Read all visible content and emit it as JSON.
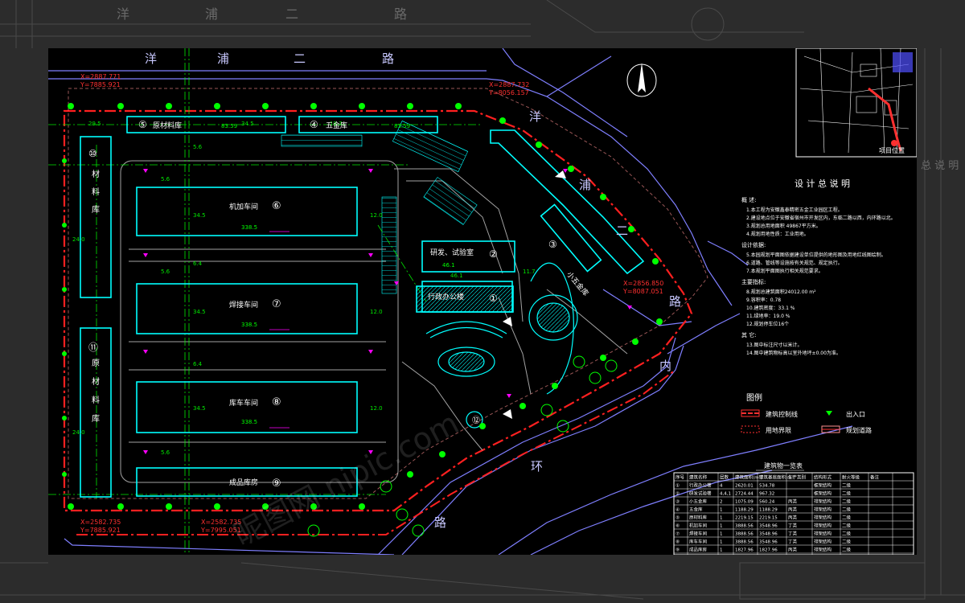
{
  "roads": {
    "road_top": "洋 浦 二 路",
    "road_right_1": "洋",
    "road_right_2": "浦",
    "road_right_3": "二",
    "road_right_4": "路",
    "road_bottom_1": "内",
    "road_bottom_2": "环",
    "road_bottom_3": "路"
  },
  "coords": {
    "tl_x": "X=2887.771",
    "tl_y": "Y=7885.921",
    "tr_x": "X=2887.732",
    "tr_y": "Y=8056.157",
    "right_x": "X=2856.850",
    "right_y": "Y=8087.051",
    "bl_x": "X=2582.735",
    "bl_y": "Y=7885.921",
    "bm_x": "X=2582.735",
    "bm_y": "Y=7995.051"
  },
  "buildings": [
    {
      "num": "⑤",
      "name": "原材料库",
      "area": "83.59"
    },
    {
      "num": "④",
      "name": "五金库",
      "area": "83.59"
    },
    {
      "num": "⑩",
      "name": "材料库",
      "area": "34.0"
    },
    {
      "num": "⑥",
      "name": "机加车间",
      "area": "338.5"
    },
    {
      "num": "⑦",
      "name": "焊接车间",
      "area": "338.5"
    },
    {
      "num": "⑧",
      "name": "库车车间",
      "area": "338.5"
    },
    {
      "num": "⑨",
      "name": "成品库房",
      "area": "338.5"
    },
    {
      "num": "⑪",
      "name": "原材料库",
      "area": "34.0"
    },
    {
      "num": "②",
      "name": "研发、试验室",
      "area": "46.1"
    },
    {
      "num": "①",
      "name": "行政办公楼",
      "area": ""
    },
    {
      "num": "③",
      "name": "小五金库",
      "area": ""
    },
    {
      "num": "⑫",
      "name": "",
      "area": ""
    }
  ],
  "notes": {
    "title": "设 计 总 说 明",
    "section1": "概 述:",
    "lines1": [
      "1.本工程为安徽鑫泰精密五金工业园区工程。",
      "2.建设地点位于安徽省宿州市开发区内，东临二路以西，内环路以北。",
      "3.规划总用地面积 49867平方米。",
      "4.规划用地性质：工业用地。"
    ],
    "section2": "设计依据:",
    "lines2": [
      "5.本园规划平面图依据建设单位提供的地形图及用地红线图绘制。",
      "6.道路、管线等设施按有关规范、规定执行。",
      "7.本规划平面图执行相关规范要求。"
    ],
    "section3": "主要指标:",
    "lines3": [
      "8.规划总建筑面积24012.00 m²",
      "9.容积率：0.78",
      "10.建筑密度：33.1 %",
      "11.绿地率：19.0 %",
      "12.规划停车位16个"
    ],
    "section4": "其 它:",
    "lines4": [
      "13.图中标注尺寸以米计。",
      "14.图中建筑物标高以室外地坪±0.00为准。"
    ]
  },
  "legend": {
    "title": "图例",
    "items": [
      "建筑控制线",
      "用地界限",
      "出入口",
      "规划道路"
    ]
  },
  "table": {
    "title": "建筑物一览表",
    "headers": [
      "序号",
      "建筑名称",
      "层数",
      "建筑面积(m²)",
      "建筑基底面积(m²)",
      "生产类别",
      "结构形式",
      "耐火等级",
      "备注"
    ],
    "rows": [
      [
        "①",
        "行政办公楼",
        "4",
        "2620.01",
        "534.78",
        "",
        "框架结构",
        "二级",
        ""
      ],
      [
        "②",
        "研发试验楼",
        "4,4,1",
        "2724.44",
        "967.32",
        "",
        "框架结构",
        "二级",
        ""
      ],
      [
        "③",
        "小五金库",
        "2",
        "1075.09",
        "560.24",
        "丙类",
        "排架结构",
        "二级",
        ""
      ],
      [
        "④",
        "五金库",
        "1",
        "1188.29",
        "1188.29",
        "丙类",
        "排架结构",
        "二级",
        ""
      ],
      [
        "⑤",
        "原材料库",
        "1",
        "2219.15",
        "2219.15",
        "丙类",
        "排架结构",
        "二级",
        ""
      ],
      [
        "⑥",
        "机加车间",
        "1",
        "3888.56",
        "3548.96",
        "丁类",
        "排架结构",
        "二级",
        ""
      ],
      [
        "⑦",
        "焊接车间",
        "1",
        "3888.56",
        "3548.96",
        "丁类",
        "排架结构",
        "二级",
        ""
      ],
      [
        "⑧",
        "库车车间",
        "1",
        "3888.56",
        "3548.96",
        "丁类",
        "排架结构",
        "二级",
        ""
      ],
      [
        "⑨",
        "成品库房",
        "1",
        "1827.96",
        "1827.96",
        "丙类",
        "排架结构",
        "二级",
        ""
      ]
    ]
  },
  "location_label": "项目位置",
  "watermark": "昵图网 nipic.com",
  "colors": {
    "background": "#000000",
    "building": "#00ffff",
    "road": "#7f7fff",
    "control_line": "#ff0000",
    "green": "#00ff00",
    "text": "#ffffff",
    "dim": "#ff00ff"
  }
}
